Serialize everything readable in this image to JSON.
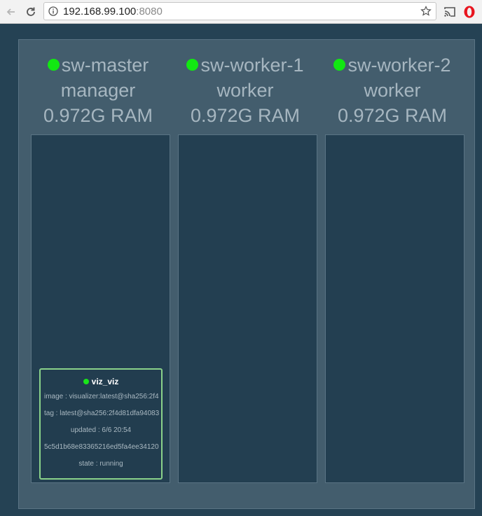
{
  "browser": {
    "url_host": "192.168.99.100",
    "url_port": ":8080"
  },
  "nodes": [
    {
      "name": "sw-master",
      "role": "manager",
      "ram": "0.972G RAM",
      "status_color": "#12e812",
      "tasks": [
        {
          "name": "viz_viz",
          "image": "image : visualizer:latest@sha256:2f4",
          "tag": "tag : latest@sha256:2f4d81dfa94083",
          "updated": "updated : 6/6 20:54",
          "id": "5c5d1b68e83365216ed5fa4ee34120",
          "state": "state : running",
          "status_color": "#19e519"
        }
      ]
    },
    {
      "name": "sw-worker-1",
      "role": "worker",
      "ram": "0.972G RAM",
      "status_color": "#12e812",
      "tasks": []
    },
    {
      "name": "sw-worker-2",
      "role": "worker",
      "ram": "0.972G RAM",
      "status_color": "#12e812",
      "tasks": []
    }
  ],
  "colors": {
    "page_bg": "#254254",
    "swarm_bg": "#435d6d",
    "column_bg": "#233f51",
    "task_border": "#8ad28a"
  }
}
